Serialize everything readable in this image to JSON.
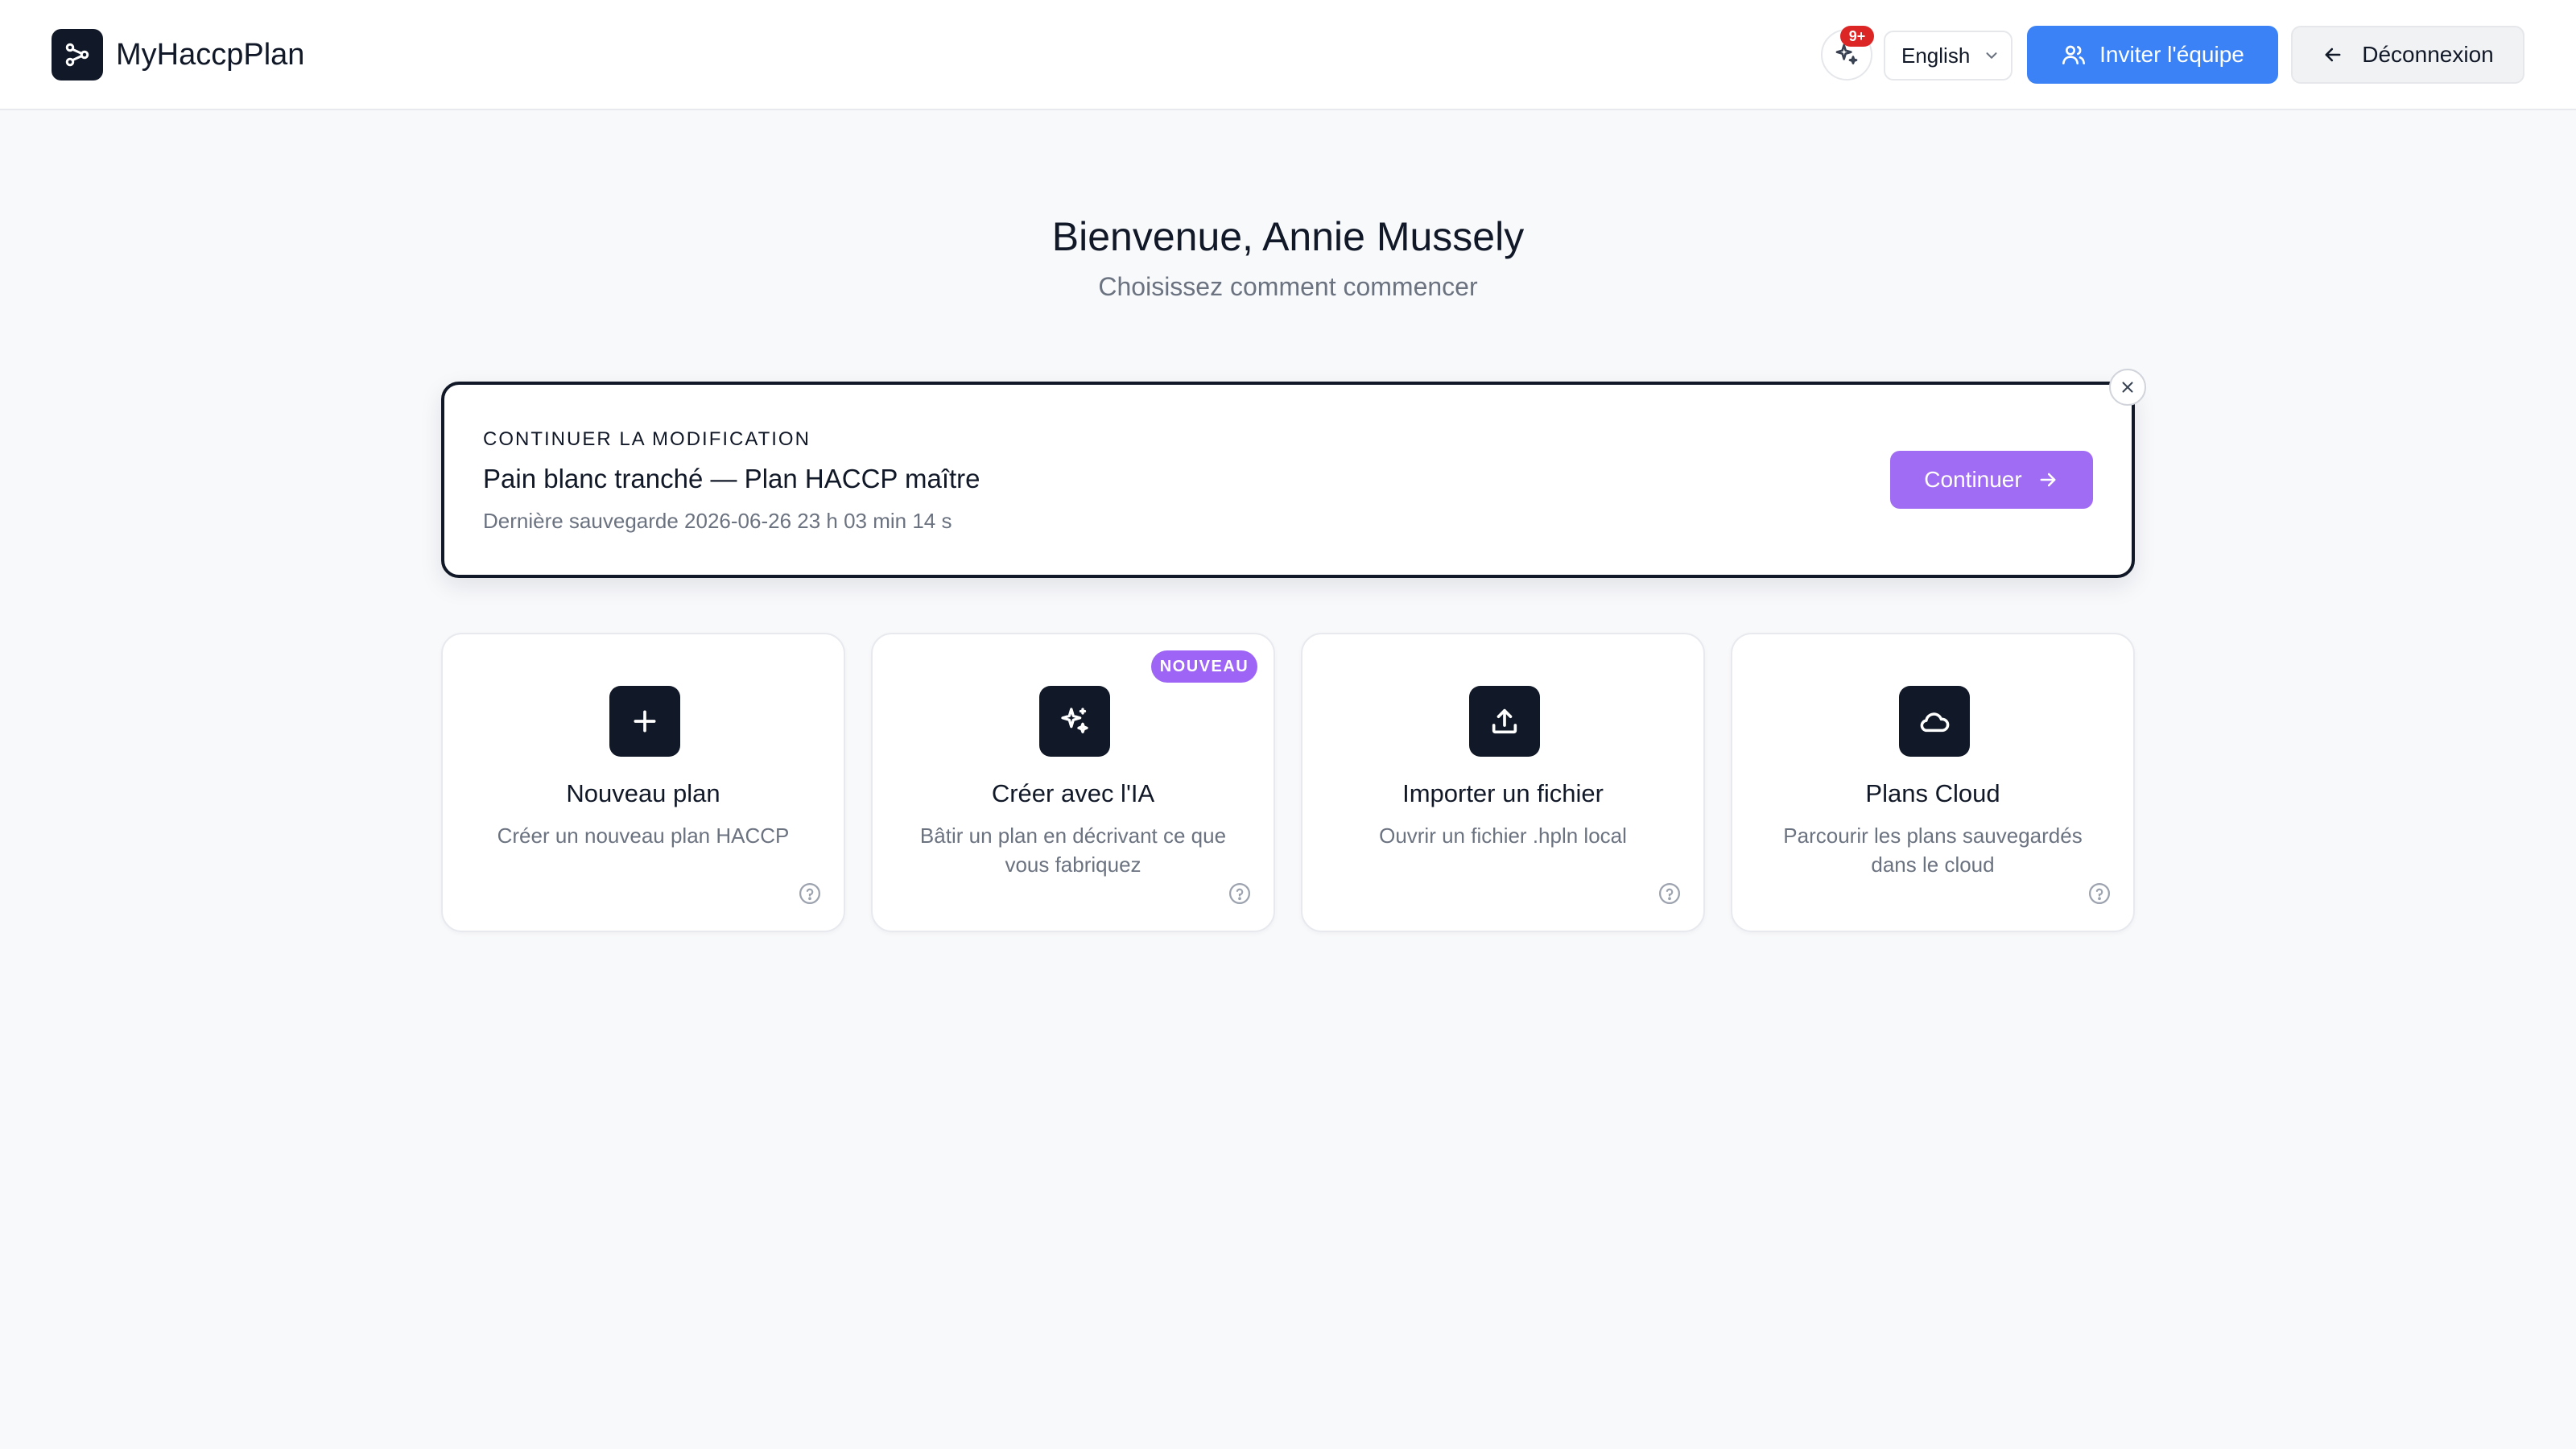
{
  "header": {
    "app_title": "MyHaccpPlan",
    "logo_icon": "branch-nodes-icon",
    "notification_count": "9+",
    "language": "English",
    "invite_label": "Inviter l'équipe",
    "logout_label": "Déconnexion"
  },
  "welcome": {
    "title": "Bienvenue, Annie Mussely",
    "subtitle": "Choisissez comment commencer"
  },
  "continue_card": {
    "kicker": "CONTINUER LA MODIFICATION",
    "plan_title": "Pain blanc tranché — Plan HACCP maître",
    "last_saved": "Dernière sauvegarde 2026-06-26 23 h 03 min 14 s",
    "button_label": "Continuer"
  },
  "options": [
    {
      "title": "Nouveau plan",
      "description": "Créer un nouveau plan HACCP",
      "icon": "plus-icon"
    },
    {
      "title": "Créer avec l'IA",
      "description": "Bâtir un plan en décrivant ce que vous fabriquez",
      "icon": "sparkles-icon",
      "badge": "NOUVEAU"
    },
    {
      "title": "Importer un fichier",
      "description": "Ouvrir un fichier .hpln local",
      "icon": "upload-icon"
    },
    {
      "title": "Plans Cloud",
      "description": "Parcourir les plans sauvegardés dans le cloud",
      "icon": "cloud-icon"
    }
  ],
  "colors": {
    "primary_blue": "#3b82f6",
    "accent_purple": "#a16cf4",
    "dark": "#111827",
    "badge_red": "#dc2626"
  }
}
